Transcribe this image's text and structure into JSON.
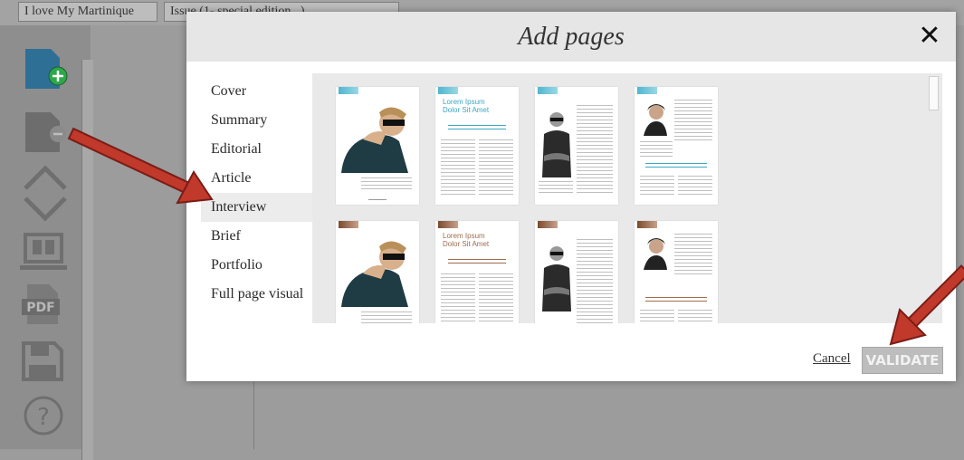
{
  "breadcrumbs": [
    "I love My Martinique",
    "Issue (1- special edition...)"
  ],
  "sidebar": {
    "tools": [
      {
        "name": "add-page-icon"
      },
      {
        "name": "remove-page-icon"
      },
      {
        "name": "move-up-icon"
      },
      {
        "name": "move-down-icon"
      },
      {
        "name": "preview-screen-icon"
      },
      {
        "name": "pdf-export-icon"
      },
      {
        "name": "save-icon"
      },
      {
        "name": "help-icon"
      }
    ],
    "pdf_label": "PDF",
    "help_label": "?"
  },
  "modal": {
    "title": "Add pages",
    "close_label": "✕",
    "categories": [
      "Cover",
      "Summary",
      "Editorial",
      "Article",
      "Interview",
      "Brief",
      "Portfolio",
      "Full page visual"
    ],
    "selected_category": "Interview",
    "template_titles": [
      "Lorem Ipsum",
      "Dolor Sit Amet"
    ],
    "cancel_label": "Cancel",
    "validate_label": "VALIDATE"
  },
  "colors": {
    "accent_teal": "#4fb6cf",
    "accent_brown": "#a06c4d",
    "annotation_arrow": "#c0392b",
    "add_badge": "#2ea84a",
    "tool_icon": "#2e6f95"
  }
}
